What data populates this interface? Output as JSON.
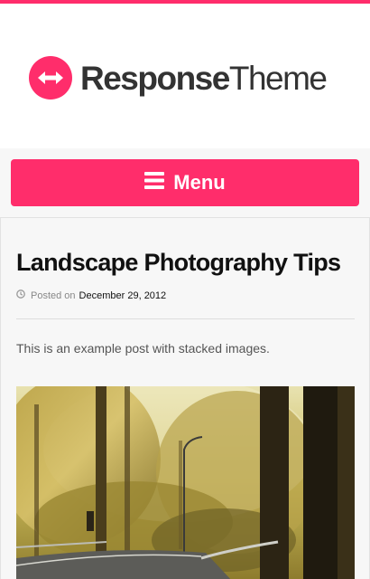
{
  "site": {
    "logo_bold": "Response",
    "logo_light": "Theme",
    "logo_icon": "double-arrow-icon",
    "accent_color": "#ff2d6b"
  },
  "nav": {
    "menu_label": "Menu",
    "menu_icon": "hamburger-icon"
  },
  "post": {
    "title": "Landscape Photography Tips",
    "posted_label": "Posted on",
    "date": "December 29, 2012",
    "meta_icon": "clock-icon",
    "excerpt": "This is an example post with stacked images.",
    "image_subject": "autumn forest road"
  }
}
